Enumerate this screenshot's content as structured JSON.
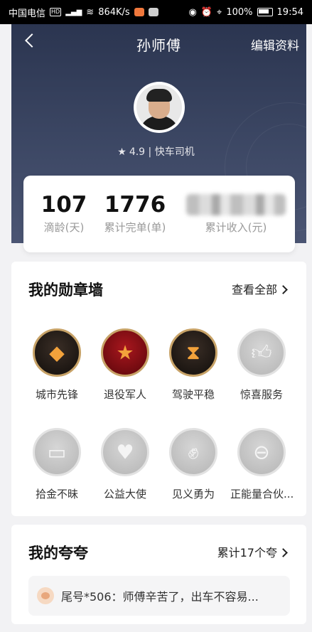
{
  "status_bar": {
    "carrier": "中国电信",
    "hd": "HD",
    "network": "4G",
    "speed": "864K/s",
    "battery": "100%",
    "time": "19:54"
  },
  "header": {
    "title": "孙师傅",
    "edit_label": "编辑资料",
    "rating": "4.9",
    "separator": "|",
    "role": "快车司机"
  },
  "stats": [
    {
      "value": "107",
      "label": "滴龄(天)"
    },
    {
      "value": "1776",
      "label": "累计完单(单)"
    },
    {
      "value": "",
      "label": "累计收入(元)"
    }
  ],
  "medals": {
    "title": "我的勋章墙",
    "link": "查看全部",
    "items": [
      {
        "label": "城市先锋",
        "icon": "pioneer-medal-icon"
      },
      {
        "label": "退役军人",
        "icon": "veteran-star-medal-icon"
      },
      {
        "label": "驾驶平稳",
        "icon": "hourglass-medal-icon"
      },
      {
        "label": "惊喜服务",
        "icon": "thumbs-up-medal-icon"
      },
      {
        "label": "拾金不昧",
        "icon": "card-medal-icon"
      },
      {
        "label": "公益大使",
        "icon": "heart-medal-icon"
      },
      {
        "label": "见义勇为",
        "icon": "muscle-medal-icon"
      },
      {
        "label": "正能量合伙...",
        "icon": "planet-medal-icon"
      }
    ]
  },
  "praise": {
    "title": "我的夸夸",
    "link": "累计17个夸",
    "comment": "尾号*506：师傅辛苦了，出车不容易..."
  }
}
